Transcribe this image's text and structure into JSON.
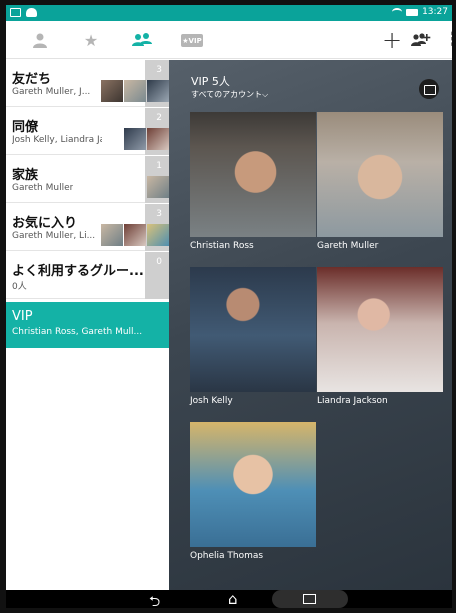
{
  "status_bar": {
    "time": "13:27"
  },
  "tabs": [
    {
      "icon": "person-icon"
    },
    {
      "icon": "star-icon"
    },
    {
      "icon": "group-icon",
      "active": true
    },
    {
      "icon": "vip-icon",
      "label": "★VIP"
    }
  ],
  "actions": {
    "add": "+",
    "add_group_icon": "add-group-icon",
    "more": "⋮"
  },
  "groups": [
    {
      "name": "友だち",
      "members": "Gareth Muller, J...",
      "count": "3"
    },
    {
      "name": "同僚",
      "members": "Josh Kelly, Liandra Ja...",
      "count": "2"
    },
    {
      "name": "家族",
      "members": "Gareth Muller",
      "count": "1"
    },
    {
      "name": "お気に入り",
      "members": "Gareth Muller, Li...",
      "count": "3"
    },
    {
      "name": "よく利用するグルー...",
      "members": "0人",
      "count": "0"
    },
    {
      "name": "VIP",
      "members": "Christian Ross, Gareth Mull...",
      "selected": true
    }
  ],
  "panel": {
    "title": "VIP 5人",
    "account_selector": "すべてのアカウント⌵",
    "contacts": [
      {
        "name": "Christian Ross"
      },
      {
        "name": "Gareth Muller"
      },
      {
        "name": "Josh Kelly"
      },
      {
        "name": "Liandra Jackson"
      },
      {
        "name": "Ophelia Thomas"
      }
    ]
  },
  "colors": {
    "accent": "#14b2a6",
    "status_bar": "#0aa39a"
  }
}
